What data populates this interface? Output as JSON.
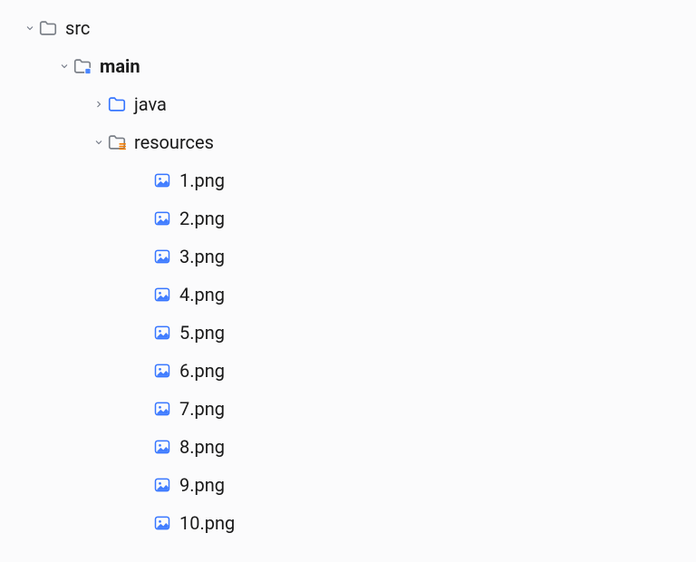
{
  "tree": {
    "src": {
      "label": "src"
    },
    "main": {
      "label": "main"
    },
    "java": {
      "label": "java"
    },
    "resources": {
      "label": "resources"
    },
    "files": [
      {
        "label": "1.png"
      },
      {
        "label": "2.png"
      },
      {
        "label": "3.png"
      },
      {
        "label": "4.png"
      },
      {
        "label": "5.png"
      },
      {
        "label": "6.png"
      },
      {
        "label": "7.png"
      },
      {
        "label": "8.png"
      },
      {
        "label": "9.png"
      },
      {
        "label": "10.png"
      }
    ]
  }
}
